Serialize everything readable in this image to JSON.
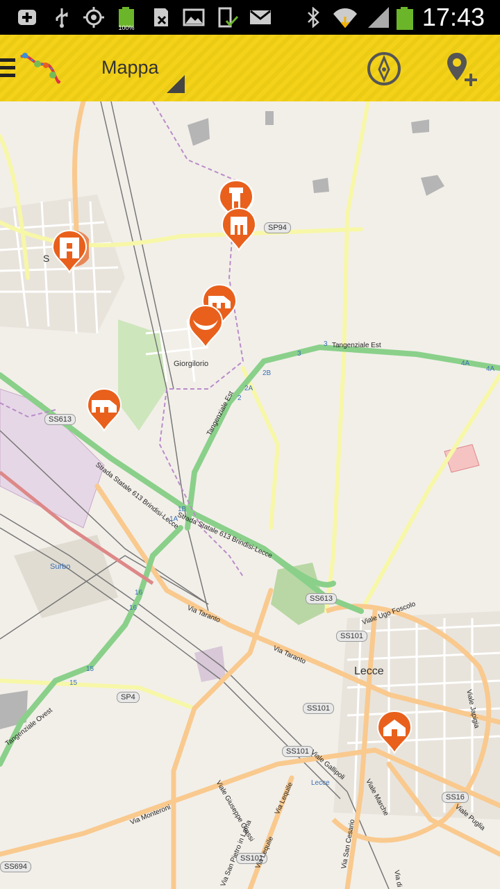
{
  "status_bar": {
    "time": "17:43",
    "battery_level": "100%",
    "icons": [
      "add-notification-icon",
      "usb-icon",
      "gps-icon",
      "battery-full-icon",
      "sd-card-icon",
      "image-icon",
      "device-check-icon",
      "gmail-icon",
      "bluetooth-icon",
      "wifi-icon",
      "signal-icon",
      "battery-icon"
    ]
  },
  "action_bar": {
    "title": "Mappa",
    "icons": [
      "menu-icon",
      "app-logo",
      "compass-icon",
      "add-location-icon"
    ],
    "accent_color": "#f5d21a"
  },
  "map": {
    "place_labels": [
      "Giorgilorio",
      "Surbo",
      "Lecce",
      "S"
    ],
    "road_labels": [
      "Tangenziale Est",
      "Tangenziale Est",
      "Strada Statale 613 Brindisi-Lecce",
      "Strada Statale 613 Brindisi-Lecce",
      "Via Taranto",
      "Via Taranto",
      "Viale Ugo Foscolo",
      "Viale Japigia",
      "Viale Gallipoli",
      "Viale Giuseppe Grassi",
      "Via Lequile",
      "Via Lequile",
      "Via San Pietro in Lama",
      "Via San Cesario",
      "Viale Marche",
      "Via di Leuca",
      "Viale Puglia",
      "Via Monteroni",
      "Tangenziale Ovest"
    ],
    "road_shields": [
      "SP94",
      "SS613",
      "SS613",
      "SS101",
      "SS101",
      "SS101",
      "SS101",
      "SS16",
      "SP4",
      "SS694"
    ],
    "junction_numbers": [
      "3",
      "3",
      "2B",
      "2A",
      "2",
      "4A",
      "4A",
      "1B",
      "1A",
      "16",
      "16",
      "15",
      "15"
    ],
    "poi_color": "#e8601c",
    "pois": [
      "castle-tower-poi",
      "castle-poi",
      "gate-poi",
      "cave-poi",
      "farmhouse-poi",
      "farmhouse-poi",
      "house-poi"
    ],
    "station_label": "Lecce"
  }
}
